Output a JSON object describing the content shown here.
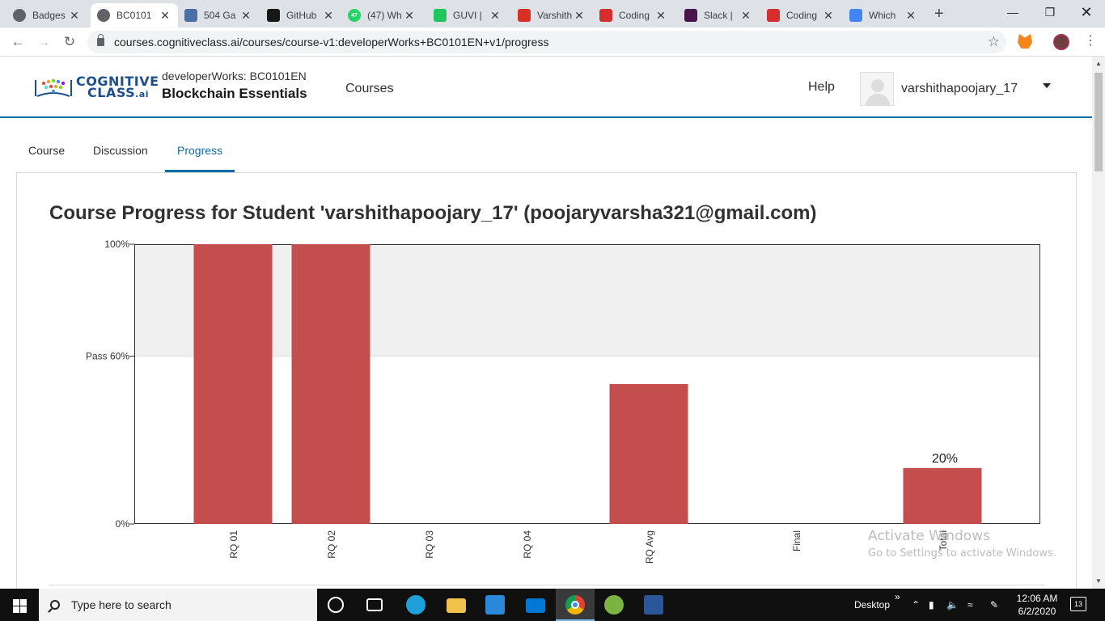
{
  "browser": {
    "tabs": [
      {
        "title": "Badges",
        "icon": "globe-icon",
        "color": "#5f6368"
      },
      {
        "title": "BC0101",
        "icon": "globe-icon",
        "color": "#5f6368",
        "active": true
      },
      {
        "title": "504 Ga",
        "icon": "gallery-icon",
        "color": "#4a6fa5"
      },
      {
        "title": "GitHub",
        "icon": "github-icon",
        "color": "#181717"
      },
      {
        "title": "(47) Wh",
        "icon": "whatsapp-icon",
        "color": "#25d366",
        "badge": "47"
      },
      {
        "title": "GUVI |",
        "icon": "guvi-icon",
        "color": "#21c55d"
      },
      {
        "title": "Varshith",
        "icon": "gmail-icon",
        "color": "#d93025"
      },
      {
        "title": "Coding",
        "icon": "tg-icon",
        "color": "#d62d2d"
      },
      {
        "title": "Slack |",
        "icon": "slack-icon",
        "color": "#4a154b"
      },
      {
        "title": "Coding",
        "icon": "tg-icon",
        "color": "#d62d2d"
      },
      {
        "title": "Which",
        "icon": "google-icon",
        "color": "#4285f4"
      }
    ],
    "url": "courses.cognitiveclass.ai/courses/course-v1:developerWorks+BC0101EN+v1/progress"
  },
  "header": {
    "logo_line1": "COGNITIVE",
    "logo_line2": "CLASS",
    "logo_suffix": ".ai",
    "course_org": "developerWorks: BC0101EN",
    "course_name": "Blockchain Essentials",
    "nav_courses": "Courses",
    "nav_help": "Help",
    "username": "varshithapoojary_17"
  },
  "course_tabs": [
    {
      "label": "Course"
    },
    {
      "label": "Discussion"
    },
    {
      "label": "Progress",
      "active": true
    }
  ],
  "page_title": "Course Progress for Student 'varshithapoojary_17' (poojaryvarsha321@gmail.com)",
  "chart_data": {
    "type": "bar",
    "categories": [
      "RQ 01",
      "RQ 02",
      "RQ 03",
      "RQ 04",
      "RQ Avg",
      "Final",
      "Total"
    ],
    "values": [
      100,
      100,
      0,
      0,
      50,
      0,
      20
    ],
    "value_labels": {
      "Total": "20%"
    },
    "ylim": [
      0,
      100
    ],
    "y_ticks": [
      {
        "value": 0,
        "label": "0%"
      },
      {
        "value": 60,
        "label": "Pass 60%"
      },
      {
        "value": 100,
        "label": "100%"
      }
    ],
    "pass_threshold": 60,
    "bar_color": "#c44d4d",
    "band_color": "#f0f0f0",
    "grid": false,
    "legend": "none"
  },
  "watermark": {
    "line1": "Activate Windows",
    "line2": "Go to Settings to activate Windows."
  },
  "taskbar": {
    "search_placeholder": "Type here to search",
    "desktop_label": "Desktop",
    "time": "12:06 AM",
    "date": "6/2/2020",
    "notifications": "13"
  }
}
